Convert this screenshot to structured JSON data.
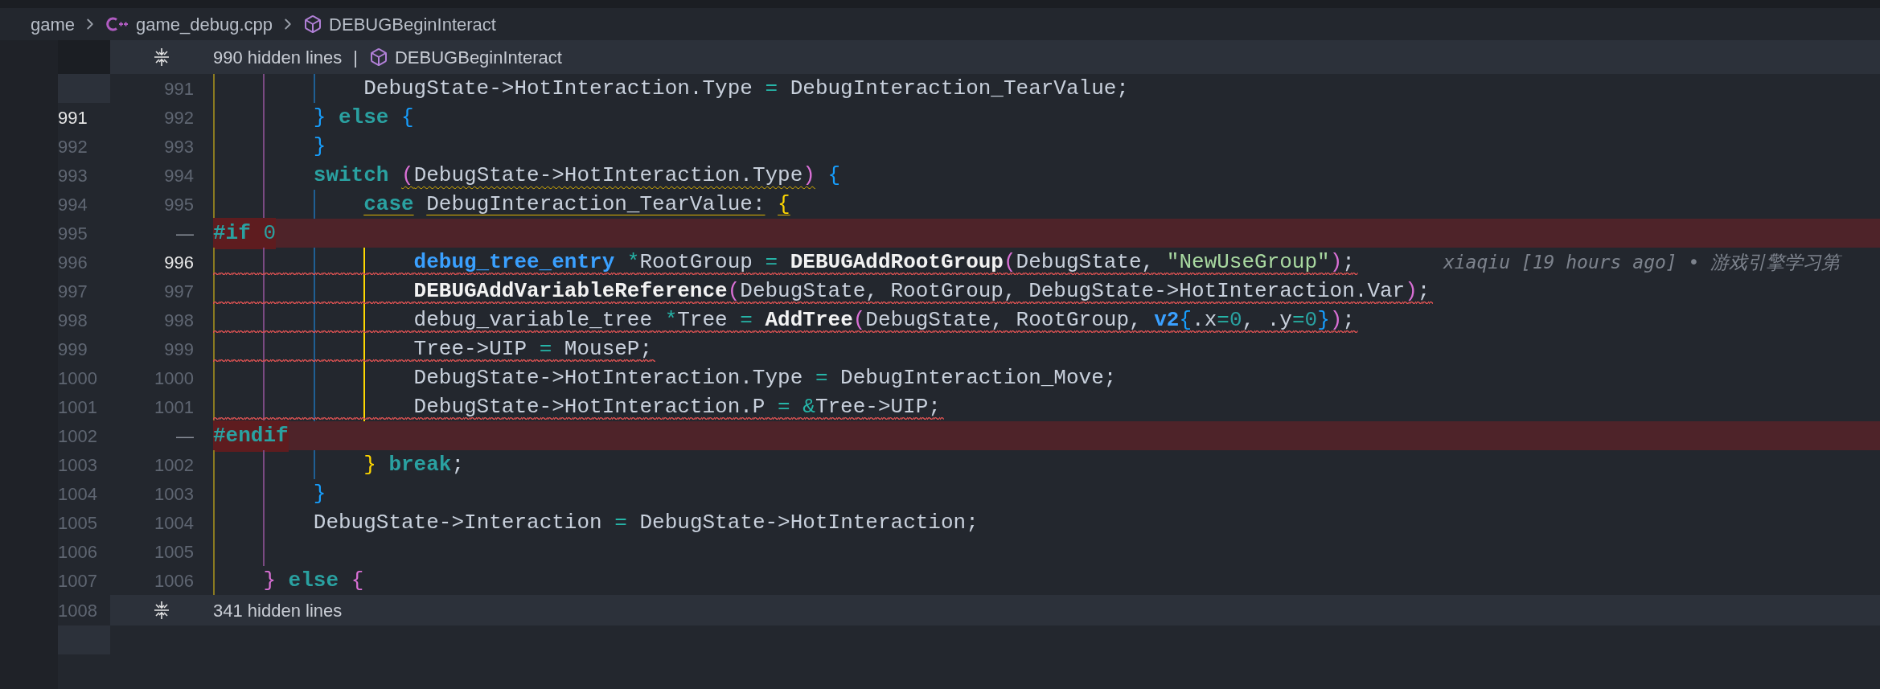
{
  "breadcrumb": [
    {
      "kind": "folder",
      "label": "game"
    },
    {
      "kind": "cpp-file",
      "label": "game_debug.cpp"
    },
    {
      "kind": "symbol",
      "label": "DEBUGBeginInteract"
    }
  ],
  "top_fold": {
    "label": "990 hidden lines",
    "separator": "|",
    "symbol": "DEBUGBeginInteract"
  },
  "lines": [
    {
      "kind": "code",
      "number": "991",
      "active": false,
      "squiggle": false,
      "tokens": [
        {
          "text": "            DebugState->HotInteraction.Type",
          "kind": "plain"
        },
        {
          "text": " =",
          "kind": "operator"
        },
        {
          "text": " DebugInteraction_TearValue;",
          "kind": "plain"
        }
      ]
    },
    {
      "kind": "code",
      "original": "991",
      "number": "992",
      "original_active": true,
      "active": false,
      "squiggle": false,
      "tokens": [
        {
          "text": "        }",
          "kind": "bracket-blue"
        },
        {
          "text": " else",
          "kind": "keyword"
        },
        {
          "text": " {",
          "kind": "bracket-blue"
        }
      ]
    },
    {
      "kind": "code",
      "original": "992",
      "number": "993",
      "original_active": false,
      "active": false,
      "squiggle": false,
      "tokens": [
        {
          "text": "        }",
          "kind": "bracket-blue"
        }
      ]
    },
    {
      "kind": "code",
      "original": "993",
      "number": "994",
      "original_active": false,
      "active": false,
      "squiggle": false,
      "tokens": [
        {
          "text": "        switch",
          "kind": "keyword",
          "warning": false
        },
        {
          "text": " (",
          "kind": "bracket-pink",
          "warning": true
        },
        {
          "text": "DebugState->HotInteraction.Type",
          "kind": "plain",
          "warning": true
        },
        {
          "text": ")",
          "kind": "bracket-pink",
          "warning": true
        },
        {
          "text": " {",
          "kind": "bracket-blue",
          "warning": false
        }
      ]
    },
    {
      "kind": "code",
      "original": "994",
      "number": "995",
      "original_active": false,
      "active": false,
      "squiggle": false,
      "tokens": [
        {
          "text": "            case",
          "kind": "keyword",
          "scope": true
        },
        {
          "text": " DebugInteraction_TearValue:",
          "kind": "plain",
          "scope": true
        },
        {
          "text": " {",
          "kind": "bracket-yellow",
          "scope": true
        }
      ]
    },
    {
      "kind": "removed",
      "original": "995",
      "marker": "—",
      "original_active": false,
      "squiggle": false,
      "tokens": [
        {
          "text": "#if",
          "kind": "preprocessor"
        },
        {
          "text": " 0",
          "kind": "number"
        }
      ]
    },
    {
      "kind": "code",
      "original": "996",
      "number": "996",
      "original_active": false,
      "active": true,
      "squiggle": true,
      "tokens": [
        {
          "text": "                debug_tree_entry",
          "kind": "type"
        },
        {
          "text": " *",
          "kind": "operator"
        },
        {
          "text": "RootGroup",
          "kind": "plain"
        },
        {
          "text": " =",
          "kind": "operator"
        },
        {
          "text": " DEBUGAddRootGroup",
          "kind": "function"
        },
        {
          "text": "(",
          "kind": "bracket-pink"
        },
        {
          "text": "DebugState,",
          "kind": "plain"
        },
        {
          "text": " \"NewUseGroup\"",
          "kind": "string"
        },
        {
          "text": ")",
          "kind": "bracket-pink"
        },
        {
          "text": ";",
          "kind": "plain"
        }
      ],
      "blame": "xiaqiu [19 hours ago] • 游戏引擎学习第"
    },
    {
      "kind": "code",
      "original": "997",
      "number": "997",
      "original_active": false,
      "active": false,
      "squiggle": true,
      "tokens": [
        {
          "text": "                DEBUGAddVariableReference",
          "kind": "function"
        },
        {
          "text": "(",
          "kind": "bracket-pink"
        },
        {
          "text": "DebugState, RootGroup, DebugState->HotInteraction.Var",
          "kind": "plain"
        },
        {
          "text": ")",
          "kind": "bracket-pink"
        },
        {
          "text": ";",
          "kind": "plain"
        }
      ]
    },
    {
      "kind": "code",
      "original": "998",
      "number": "998",
      "original_active": false,
      "active": false,
      "squiggle": true,
      "tokens": [
        {
          "text": "                debug_variable_tree",
          "kind": "plain"
        },
        {
          "text": " *",
          "kind": "operator"
        },
        {
          "text": "Tree",
          "kind": "plain"
        },
        {
          "text": " =",
          "kind": "operator"
        },
        {
          "text": " AddTree",
          "kind": "function"
        },
        {
          "text": "(",
          "kind": "bracket-pink"
        },
        {
          "text": "DebugState, RootGroup,",
          "kind": "plain"
        },
        {
          "text": " v2",
          "kind": "type"
        },
        {
          "text": "{",
          "kind": "bracket-blue"
        },
        {
          "text": ".x",
          "kind": "plain"
        },
        {
          "text": "=",
          "kind": "operator"
        },
        {
          "text": "0",
          "kind": "number"
        },
        {
          "text": ", .y",
          "kind": "plain"
        },
        {
          "text": "=",
          "kind": "operator"
        },
        {
          "text": "0",
          "kind": "number"
        },
        {
          "text": "}",
          "kind": "bracket-blue"
        },
        {
          "text": ")",
          "kind": "bracket-pink"
        },
        {
          "text": ";",
          "kind": "plain"
        }
      ]
    },
    {
      "kind": "code",
      "original": "999",
      "number": "999",
      "original_active": false,
      "active": false,
      "squiggle": true,
      "tokens": [
        {
          "text": "                Tree->UIP",
          "kind": "plain"
        },
        {
          "text": " =",
          "kind": "operator"
        },
        {
          "text": " MouseP;",
          "kind": "plain"
        }
      ]
    },
    {
      "kind": "code",
      "original": "1000",
      "number": "1000",
      "original_active": false,
      "active": false,
      "squiggle": false,
      "tokens": [
        {
          "text": "                DebugState->HotInteraction.Type",
          "kind": "plain"
        },
        {
          "text": " =",
          "kind": "operator"
        },
        {
          "text": " DebugInteraction_Move;",
          "kind": "plain"
        }
      ]
    },
    {
      "kind": "code",
      "original": "1001",
      "number": "1001",
      "original_active": false,
      "active": false,
      "squiggle": true,
      "tokens": [
        {
          "text": "                DebugState->HotInteraction.P",
          "kind": "plain"
        },
        {
          "text": " =",
          "kind": "operator"
        },
        {
          "text": " &",
          "kind": "operator"
        },
        {
          "text": "Tree->UIP;",
          "kind": "plain"
        }
      ]
    },
    {
      "kind": "removed",
      "original": "1002",
      "marker": "—",
      "original_active": false,
      "squiggle": false,
      "tokens": [
        {
          "text": "#endif",
          "kind": "preprocessor"
        }
      ]
    },
    {
      "kind": "code",
      "original": "1003",
      "number": "1002",
      "original_active": false,
      "active": false,
      "squiggle": false,
      "tokens": [
        {
          "text": "            }",
          "kind": "bracket-yellow"
        },
        {
          "text": " break",
          "kind": "keyword"
        },
        {
          "text": ";",
          "kind": "plain"
        }
      ]
    },
    {
      "kind": "code",
      "original": "1004",
      "number": "1003",
      "original_active": false,
      "active": false,
      "squiggle": false,
      "tokens": [
        {
          "text": "        }",
          "kind": "bracket-blue"
        }
      ]
    },
    {
      "kind": "code",
      "original": "1005",
      "number": "1004",
      "original_active": false,
      "active": false,
      "squiggle": false,
      "tokens": [
        {
          "text": "        DebugState->Interaction",
          "kind": "plain"
        },
        {
          "text": " =",
          "kind": "operator"
        },
        {
          "text": " DebugState->HotInteraction;",
          "kind": "plain"
        }
      ]
    },
    {
      "kind": "code",
      "original": "1006",
      "number": "1005",
      "original_active": false,
      "active": false,
      "squiggle": false
    },
    {
      "kind": "code",
      "original": "1007",
      "number": "1006",
      "original_active": false,
      "active": false,
      "squiggle": false,
      "tokens": [
        {
          "text": "    }",
          "kind": "bracket-pink"
        },
        {
          "text": " else",
          "kind": "keyword"
        },
        {
          "text": " {",
          "kind": "bracket-pink"
        }
      ]
    }
  ],
  "bottom_fold": {
    "original": "1008",
    "label": "341 hidden lines"
  }
}
